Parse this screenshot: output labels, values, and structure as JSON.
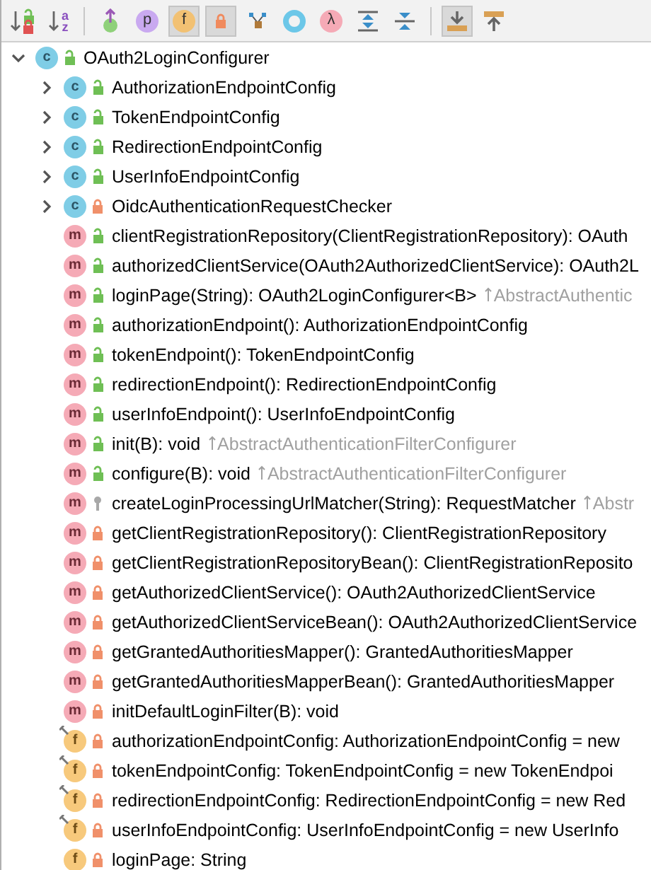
{
  "toolbar": [
    {
      "kind": "sort-visibility",
      "selected": false
    },
    {
      "kind": "sort-alpha",
      "glyphs": [
        "a",
        "z"
      ],
      "selected": false
    },
    {
      "kind": "separator"
    },
    {
      "kind": "inherited",
      "selected": false
    },
    {
      "kind": "properties",
      "glyph": "p",
      "selected": false
    },
    {
      "kind": "fields",
      "glyph": "f",
      "selected": true
    },
    {
      "kind": "non-public",
      "selected": true
    },
    {
      "kind": "graph",
      "selected": false
    },
    {
      "kind": "ring",
      "selected": false
    },
    {
      "kind": "lambda",
      "glyph": "λ",
      "selected": false
    },
    {
      "kind": "expand-all",
      "selected": false
    },
    {
      "kind": "collapse-all",
      "selected": false
    },
    {
      "kind": "separator"
    },
    {
      "kind": "scroll-to-source",
      "selected": true
    },
    {
      "kind": "scroll-from-source",
      "selected": false
    }
  ],
  "tree": {
    "kind": "class",
    "badge": "c",
    "private": false,
    "protected": false,
    "name": "OAuth2LoginConfigurer",
    "expanded": true,
    "children": [
      {
        "kind": "class",
        "badge": "c",
        "private": false,
        "protected": false,
        "name": "AuthorizationEndpointConfig",
        "expanded": false
      },
      {
        "kind": "class",
        "badge": "c",
        "private": false,
        "protected": false,
        "name": "TokenEndpointConfig",
        "expanded": false
      },
      {
        "kind": "class",
        "badge": "c",
        "private": false,
        "protected": false,
        "name": "RedirectionEndpointConfig",
        "expanded": false
      },
      {
        "kind": "class",
        "badge": "c",
        "private": false,
        "protected": false,
        "name": "UserInfoEndpointConfig",
        "expanded": false
      },
      {
        "kind": "class",
        "badge": "c",
        "private": true,
        "protected": false,
        "name": "OidcAuthenticationRequestChecker",
        "expanded": false
      },
      {
        "kind": "method",
        "badge": "m",
        "private": false,
        "protected": false,
        "name": "clientRegistrationRepository(ClientRegistrationRepository): OAuth"
      },
      {
        "kind": "method",
        "badge": "m",
        "private": false,
        "protected": false,
        "name": "authorizedClientService(OAuth2AuthorizedClientService): OAuth2L"
      },
      {
        "kind": "method",
        "badge": "m",
        "private": false,
        "protected": false,
        "name": "loginPage(String): OAuth2LoginConfigurer<B>",
        "inherited": "AbstractAuthentic"
      },
      {
        "kind": "method",
        "badge": "m",
        "private": false,
        "protected": false,
        "name": "authorizationEndpoint(): AuthorizationEndpointConfig"
      },
      {
        "kind": "method",
        "badge": "m",
        "private": false,
        "protected": false,
        "name": "tokenEndpoint(): TokenEndpointConfig"
      },
      {
        "kind": "method",
        "badge": "m",
        "private": false,
        "protected": false,
        "name": "redirectionEndpoint(): RedirectionEndpointConfig"
      },
      {
        "kind": "method",
        "badge": "m",
        "private": false,
        "protected": false,
        "name": "userInfoEndpoint(): UserInfoEndpointConfig"
      },
      {
        "kind": "method",
        "badge": "m",
        "private": false,
        "protected": false,
        "name": "init(B): void",
        "inherited": "AbstractAuthenticationFilterConfigurer"
      },
      {
        "kind": "method",
        "badge": "m",
        "private": false,
        "protected": false,
        "name": "configure(B): void",
        "inherited": "AbstractAuthenticationFilterConfigurer"
      },
      {
        "kind": "method",
        "badge": "m",
        "private": false,
        "protected": true,
        "name": "createLoginProcessingUrlMatcher(String): RequestMatcher",
        "inherited": "Abstr"
      },
      {
        "kind": "method",
        "badge": "m",
        "private": true,
        "protected": false,
        "name": "getClientRegistrationRepository(): ClientRegistrationRepository"
      },
      {
        "kind": "method",
        "badge": "m",
        "private": true,
        "protected": false,
        "name": "getClientRegistrationRepositoryBean(): ClientRegistrationReposito"
      },
      {
        "kind": "method",
        "badge": "m",
        "private": true,
        "protected": false,
        "name": "getAuthorizedClientService(): OAuth2AuthorizedClientService"
      },
      {
        "kind": "method",
        "badge": "m",
        "private": true,
        "protected": false,
        "name": "getAuthorizedClientServiceBean(): OAuth2AuthorizedClientService"
      },
      {
        "kind": "method",
        "badge": "m",
        "private": true,
        "protected": false,
        "name": "getGrantedAuthoritiesMapper(): GrantedAuthoritiesMapper"
      },
      {
        "kind": "method",
        "badge": "m",
        "private": true,
        "protected": false,
        "name": "getGrantedAuthoritiesMapperBean(): GrantedAuthoritiesMapper"
      },
      {
        "kind": "method",
        "badge": "m",
        "private": true,
        "protected": false,
        "name": "initDefaultLoginFilter(B): void"
      },
      {
        "kind": "field",
        "badge": "f",
        "private": true,
        "protected": false,
        "final": true,
        "name": "authorizationEndpointConfig: AuthorizationEndpointConfig = new"
      },
      {
        "kind": "field",
        "badge": "f",
        "private": true,
        "protected": false,
        "final": true,
        "name": "tokenEndpointConfig: TokenEndpointConfig = new TokenEndpoi"
      },
      {
        "kind": "field",
        "badge": "f",
        "private": true,
        "protected": false,
        "final": true,
        "name": "redirectionEndpointConfig: RedirectionEndpointConfig = new Red"
      },
      {
        "kind": "field",
        "badge": "f",
        "private": true,
        "protected": false,
        "final": true,
        "name": "userInfoEndpointConfig: UserInfoEndpointConfig = new UserInfo"
      },
      {
        "kind": "field",
        "badge": "f",
        "private": true,
        "protected": false,
        "final": false,
        "name": "loginPage: String"
      }
    ]
  }
}
